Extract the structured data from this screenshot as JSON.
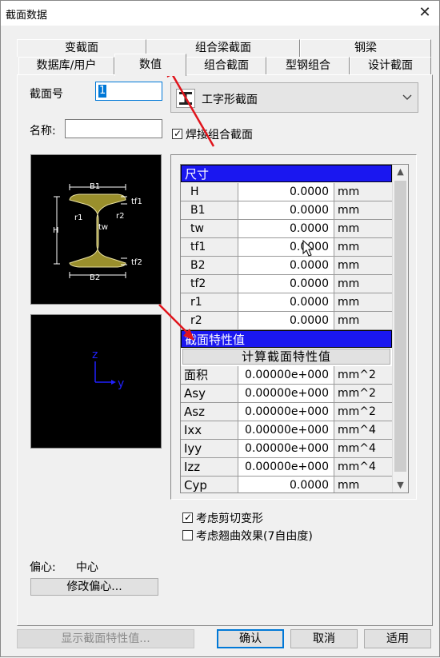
{
  "window": {
    "title": "截面数据",
    "close_glyph": "✕"
  },
  "tabs_back": [
    "变截面",
    "组合梁截面",
    "钢梁"
  ],
  "tabs_front": [
    "数据库/用户",
    "数值",
    "组合截面",
    "型钢组合",
    "设计截面"
  ],
  "section_no": {
    "label": "截面号",
    "value": "1"
  },
  "name": {
    "label": "名称:",
    "value": ""
  },
  "shape_combo": {
    "value": "工字形截面",
    "icon": "ibeam-icon"
  },
  "welded_checkbox": {
    "label": "焊接组合截面",
    "checked": true
  },
  "sketch_labels": {
    "b1": "B1",
    "b2": "B2",
    "tf1": "tf1",
    "tf2": "tf2",
    "r1": "r1",
    "r2": "r2",
    "tw": "tw",
    "h": "H"
  },
  "axis_labels": {
    "z": "z",
    "y": "y"
  },
  "grid": {
    "dim_header": "尺寸",
    "dims": [
      {
        "name": "H",
        "value": "0.0000",
        "unit": "mm"
      },
      {
        "name": "B1",
        "value": "0.0000",
        "unit": "mm"
      },
      {
        "name": "tw",
        "value": "0.0000",
        "unit": "mm"
      },
      {
        "name": "tf1",
        "value": "0.0000",
        "unit": "mm"
      },
      {
        "name": "B2",
        "value": "0.0000",
        "unit": "mm"
      },
      {
        "name": "tf2",
        "value": "0.0000",
        "unit": "mm"
      },
      {
        "name": "r1",
        "value": "0.0000",
        "unit": "mm"
      },
      {
        "name": "r2",
        "value": "0.0000",
        "unit": "mm"
      }
    ],
    "prop_header": "截面特性值",
    "calc_button": "计算截面特性值",
    "props": [
      {
        "name": "面积",
        "value": "0.00000e+000",
        "unit": "mm^2"
      },
      {
        "name": "Asy",
        "value": "0.00000e+000",
        "unit": "mm^2"
      },
      {
        "name": "Asz",
        "value": "0.00000e+000",
        "unit": "mm^2"
      },
      {
        "name": "Ixx",
        "value": "0.00000e+000",
        "unit": "mm^4"
      },
      {
        "name": "Iyy",
        "value": "0.00000e+000",
        "unit": "mm^4"
      },
      {
        "name": "Izz",
        "value": "0.00000e+000",
        "unit": "mm^4"
      },
      {
        "name": "Cyp",
        "value": "0.0000",
        "unit": "mm"
      }
    ]
  },
  "options": [
    {
      "label": "考虑剪切变形",
      "checked": true
    },
    {
      "label": "考虑翘曲效果(7自由度)",
      "checked": false
    }
  ],
  "offset": {
    "label": "偏心:",
    "value": "中心",
    "button": "修改偏心..."
  },
  "footer": {
    "show_props": "显示截面特性值...",
    "ok": "确认",
    "cancel": "取消",
    "apply": "适用"
  },
  "colors": {
    "header_blue": "#1a17f0",
    "ibeam_fill": "#9a8f2c",
    "arrow_red": "#e0141c",
    "axis_blue": "#2020ff"
  }
}
